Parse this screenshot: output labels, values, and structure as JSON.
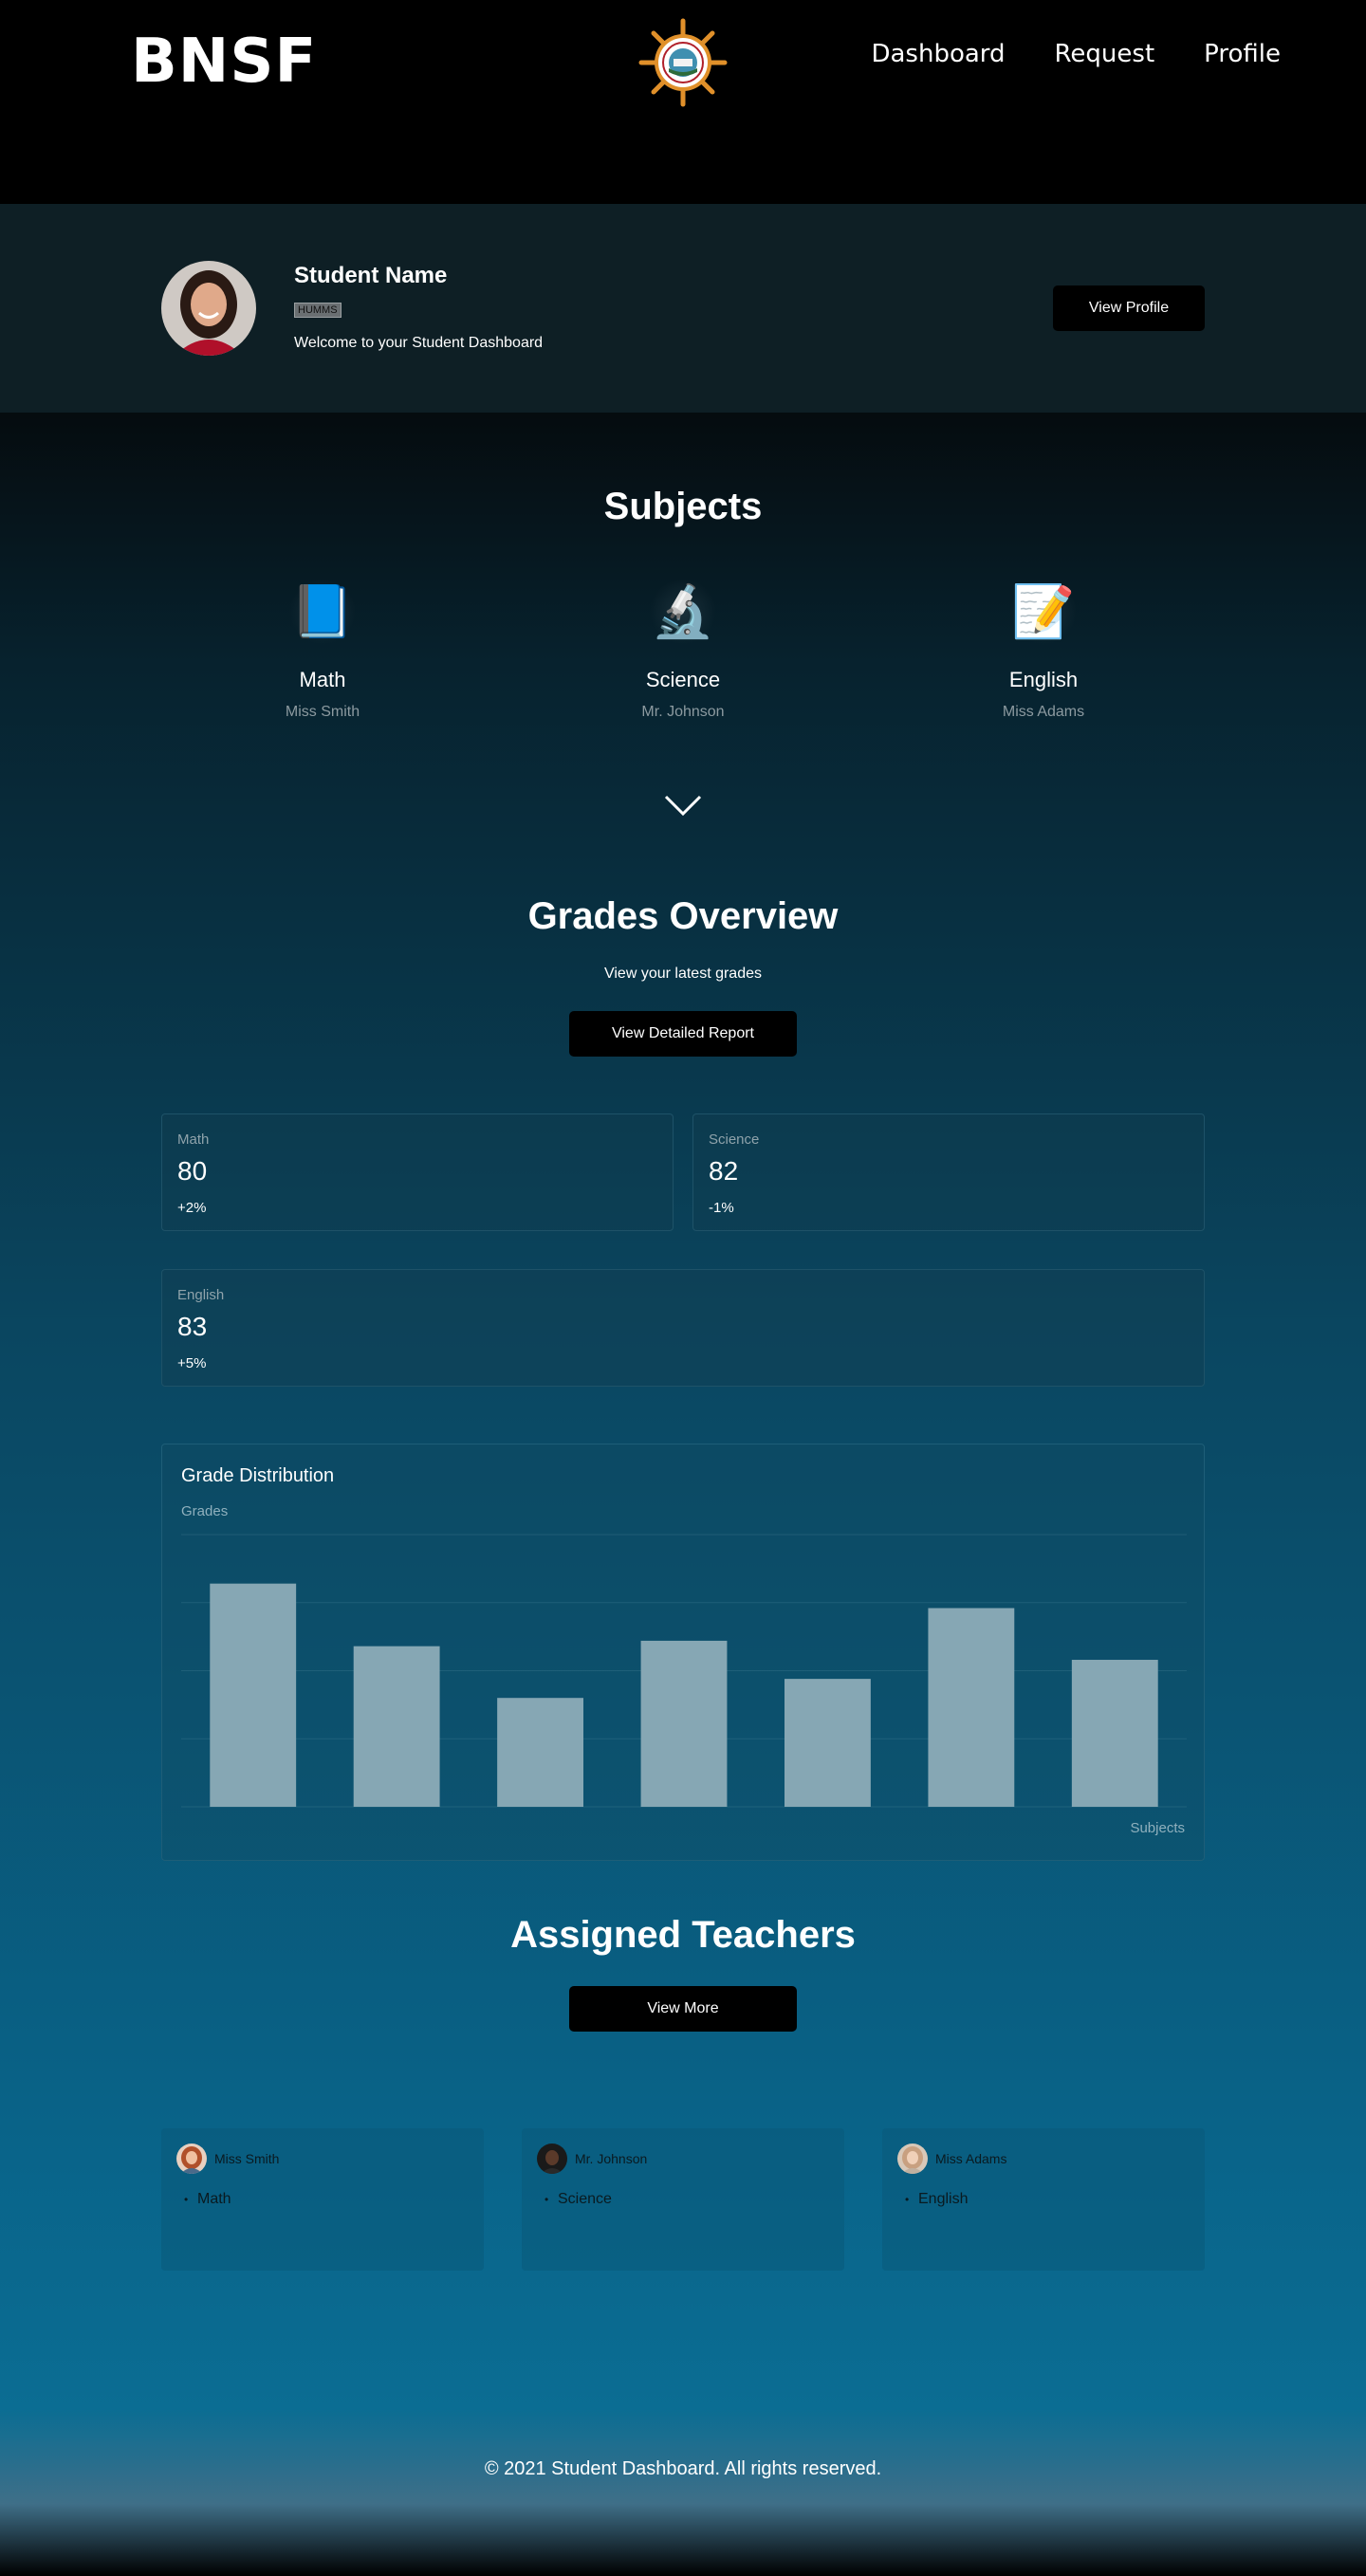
{
  "header": {
    "logo": "BNSF",
    "nav": [
      "Dashboard",
      "Request",
      "Profile"
    ]
  },
  "profile": {
    "name": "Student Name",
    "tag": "HUMMS",
    "welcome": "Welcome to your Student Dashboard",
    "button": "View Profile"
  },
  "subjects": {
    "title": "Subjects",
    "items": [
      {
        "name": "Math",
        "teacher": "Miss Smith",
        "icon": "book-icon"
      },
      {
        "name": "Science",
        "teacher": "Mr. Johnson",
        "icon": "microscope-icon"
      },
      {
        "name": "English",
        "teacher": "Miss Adams",
        "icon": "memo-icon"
      }
    ]
  },
  "grades": {
    "title": "Grades Overview",
    "subtitle": "View your latest grades",
    "button": "View Detailed Report",
    "cards": [
      {
        "subject": "Math",
        "value": "80",
        "change": "+2%"
      },
      {
        "subject": "Science",
        "value": "82",
        "change": "-1%"
      },
      {
        "subject": "English",
        "value": "83",
        "change": "+5%"
      }
    ]
  },
  "chart_data": {
    "type": "bar",
    "title": "Grade Distribution",
    "ylabel": "Grades",
    "xlabel": "Subjects",
    "categories": [
      "",
      "",
      "",
      "",
      "",
      "",
      ""
    ],
    "values": [
      82,
      59,
      40,
      61,
      47,
      73,
      54
    ],
    "ylim": [
      0,
      100
    ],
    "grid": true,
    "bar_color": "#86a7b4"
  },
  "teachers": {
    "title": "Assigned Teachers",
    "button": "View More",
    "items": [
      {
        "name": "Miss Smith",
        "subject": "Math"
      },
      {
        "name": "Mr. Johnson",
        "subject": "Science"
      },
      {
        "name": "Miss Adams",
        "subject": "English"
      }
    ]
  },
  "footer": {
    "text": "© 2021 Student Dashboard. All rights reserved."
  }
}
